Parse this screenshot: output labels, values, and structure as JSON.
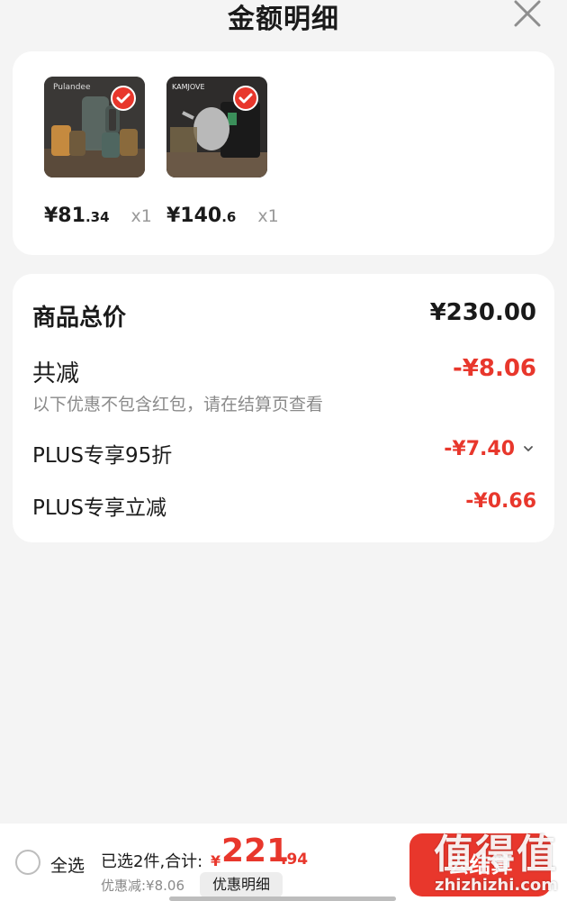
{
  "header": {
    "title": "金额明细",
    "close_icon": "close-icon"
  },
  "items": [
    {
      "image_desc": "glass-tea-set-image",
      "price_int": "¥81",
      "price_frac": ".34",
      "qty": "x1",
      "checked": true
    },
    {
      "image_desc": "electric-kettle-image",
      "price_int": "¥140",
      "price_frac": ".6",
      "qty": "x1",
      "checked": true
    }
  ],
  "summary": {
    "total_label": "商品总价",
    "total_value": "¥230.00",
    "reduce_label": "共减",
    "reduce_value": "-¥8.06",
    "note": "以下优惠不包含红包，请在结算页查看",
    "discounts": [
      {
        "label": "PLUS专享95折",
        "value": "-¥7.40",
        "expandable": true
      },
      {
        "label": "PLUS专享立减",
        "value": "-¥0.66",
        "expandable": false
      }
    ]
  },
  "bottom_bar": {
    "select_all": "全选",
    "selected_text": "已选2件,合计:",
    "total_yen": "¥",
    "total_int": "221",
    "total_frac": ".94",
    "discount_text": "优惠减:¥8.06",
    "detail_button": "优惠明细",
    "checkout_button": "去结算"
  },
  "watermark": {
    "main": "值得值",
    "sub": "zhizhizhi.com"
  },
  "colors": {
    "accent": "#e8372c",
    "text": "#1a1a1a",
    "muted": "#8a8a8a",
    "background": "#f4f4f4"
  }
}
